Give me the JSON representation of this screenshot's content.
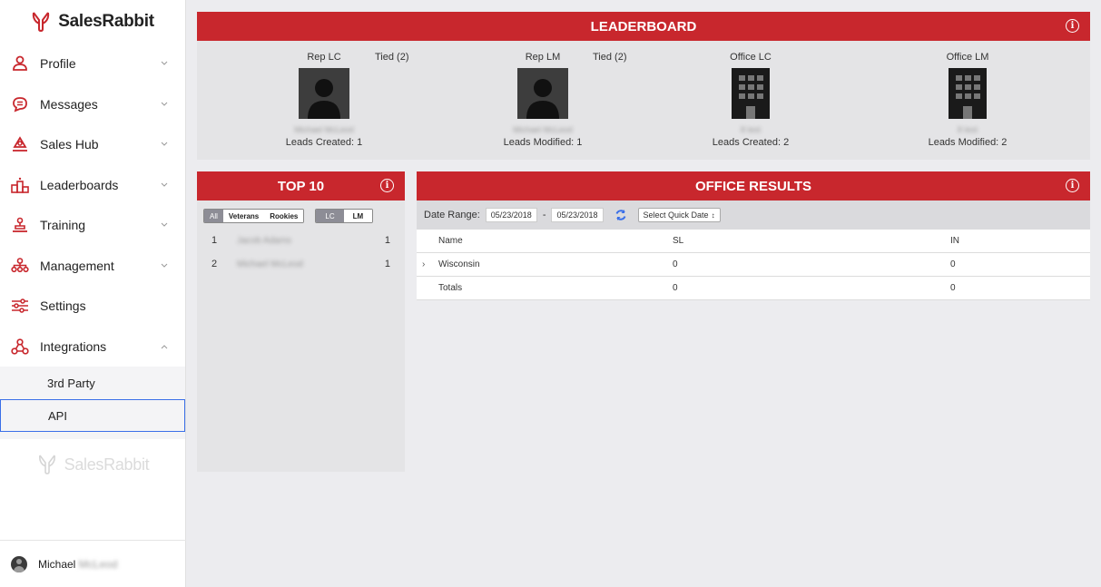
{
  "brand": {
    "name": "SalesRabbit"
  },
  "sidebar": {
    "items": [
      {
        "label": "Profile",
        "icon": "person-icon",
        "chevron": "down"
      },
      {
        "label": "Messages",
        "icon": "chat-icon",
        "chevron": "down"
      },
      {
        "label": "Sales Hub",
        "icon": "hub-icon",
        "chevron": "down"
      },
      {
        "label": "Leaderboards",
        "icon": "podium-icon",
        "chevron": "down"
      },
      {
        "label": "Training",
        "icon": "training-icon",
        "chevron": "down"
      },
      {
        "label": "Management",
        "icon": "org-chart-icon",
        "chevron": "down"
      },
      {
        "label": "Settings",
        "icon": "sliders-icon",
        "chevron": "none"
      },
      {
        "label": "Integrations",
        "icon": "integrations-icon",
        "chevron": "up"
      }
    ],
    "subitems": [
      {
        "label": "3rd Party"
      },
      {
        "label": "API"
      }
    ]
  },
  "footer_logo": "SalesRabbit",
  "user": {
    "first_name": "Michael",
    "last_name": "McLeod"
  },
  "leaderboard": {
    "title": "LEADERBOARD",
    "cards": [
      {
        "title": "Rep LC",
        "name": "Michael McLeod",
        "metric": "Leads Created: 1",
        "tied": "Tied (2)"
      },
      {
        "title": "Rep LM",
        "name": "Michael McLeod",
        "metric": "Leads Modified: 1",
        "tied": "Tied (2)"
      },
      {
        "title": "Office LC",
        "name": "8 test",
        "metric": "Leads Created: 2"
      },
      {
        "title": "Office LM",
        "name": "8 test",
        "metric": "Leads Modified: 2"
      }
    ]
  },
  "top10": {
    "title": "TOP 10",
    "filters_a": [
      "All",
      "Veterans",
      "Rookies"
    ],
    "filters_b": [
      "LC",
      "LM"
    ],
    "rows": [
      {
        "rank": "1",
        "name": "Jacob Adams",
        "value": "1"
      },
      {
        "rank": "2",
        "name": "Michael McLeod",
        "value": "1"
      }
    ]
  },
  "office_results": {
    "title": "OFFICE RESULTS",
    "date_range_label": "Date Range:",
    "date_from": "05/23/2018",
    "date_sep": "-",
    "date_to": "05/23/2018",
    "quick_date": "Select Quick Date",
    "columns": [
      "Name",
      "SL",
      "IN"
    ],
    "rows": [
      {
        "name": "Wisconsin",
        "sl": "0",
        "in": "0",
        "expandable": true
      },
      {
        "name": "Totals",
        "sl": "0",
        "in": "0",
        "expandable": false
      }
    ]
  },
  "colors": {
    "accent": "#c8272d",
    "highlight": "#3a6fe8"
  }
}
